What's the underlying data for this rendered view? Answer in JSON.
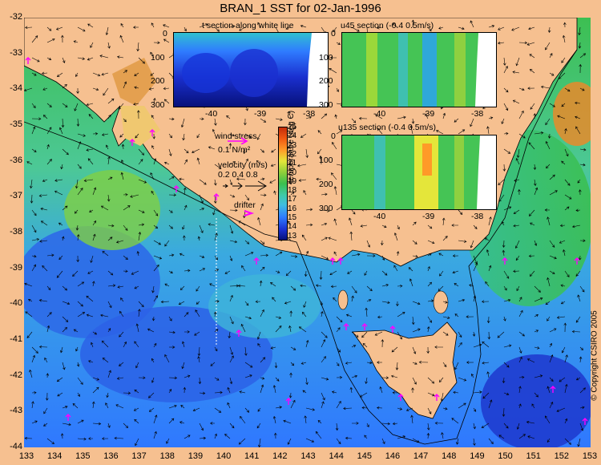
{
  "title": "BRAN_1 SST for 02-Jan-1996",
  "lat_labels": [
    "-32",
    "-33",
    "-34",
    "-35",
    "-36",
    "-37",
    "-38",
    "-39",
    "-40",
    "-41",
    "-42",
    "-43",
    "-44"
  ],
  "lon_labels": [
    "133",
    "134",
    "135",
    "136",
    "137",
    "138",
    "139",
    "140",
    "141",
    "142",
    "143",
    "144",
    "145",
    "146",
    "147",
    "148",
    "149",
    "150",
    "151",
    "152",
    "153"
  ],
  "copyright": "© Copyright CSIRO 2005",
  "inset_t": {
    "title": "t section along white line",
    "y_labels": [
      "0",
      "100",
      "200",
      "300"
    ],
    "x_labels": [
      "-40",
      "-39",
      "-38"
    ]
  },
  "inset_u45": {
    "title": "u45 section (-0.4      0.5m/s)",
    "y_labels": [
      "0",
      "100",
      "200",
      "300"
    ],
    "x_labels": [
      "-40",
      "-39",
      "-38"
    ]
  },
  "inset_u135": {
    "title": "u135 section (-0.4      0.5m/s)",
    "y_labels": [
      "0",
      "100",
      "200",
      "300"
    ],
    "x_labels": [
      "-40",
      "-39",
      "-38"
    ]
  },
  "legend": {
    "wind_stress": "wind stress",
    "wind_scale": "0.1 N/m²",
    "velocity": "velocity (m/s)",
    "velocity_scale": "0.2 0.4 0.8",
    "drifter": "drifter"
  },
  "colorbar": {
    "label": "temperature (deg C)",
    "ticks": [
      "25",
      "24",
      "23",
      "22",
      "21",
      "20",
      "19",
      "18",
      "17",
      "16",
      "15",
      "14",
      "13"
    ]
  },
  "colors": {
    "land": "#f6c090",
    "arrow": "#000000",
    "drifter": "#ff00ff",
    "warm": "#3bbf4e",
    "cool": "#2f7bff"
  }
}
